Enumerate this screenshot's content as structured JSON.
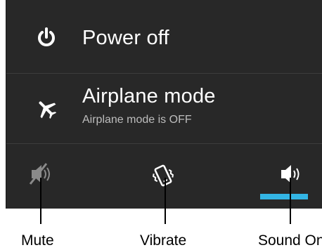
{
  "menu": {
    "power": {
      "label": "Power off",
      "icon": "power-icon"
    },
    "airplane": {
      "label": "Airplane mode",
      "status": "Airplane mode is OFF",
      "icon": "airplane-icon"
    }
  },
  "sound_modes": [
    {
      "id": "mute",
      "icon": "speaker-muted-icon",
      "selected": false
    },
    {
      "id": "vibrate",
      "icon": "vibrate-icon",
      "selected": false
    },
    {
      "id": "sound_on",
      "icon": "speaker-on-icon",
      "selected": true
    }
  ],
  "callouts": {
    "mute": "Mute",
    "vibrate": "Vibrate",
    "sound_on": "Sound On"
  },
  "colors": {
    "dialog_background": "#282828",
    "divider": "#3c3c3c",
    "selected_accent": "#33b5e5",
    "text_primary": "#ffffff",
    "text_secondary": "#bdbdbd",
    "icon_inactive": "#9a9a9a"
  }
}
